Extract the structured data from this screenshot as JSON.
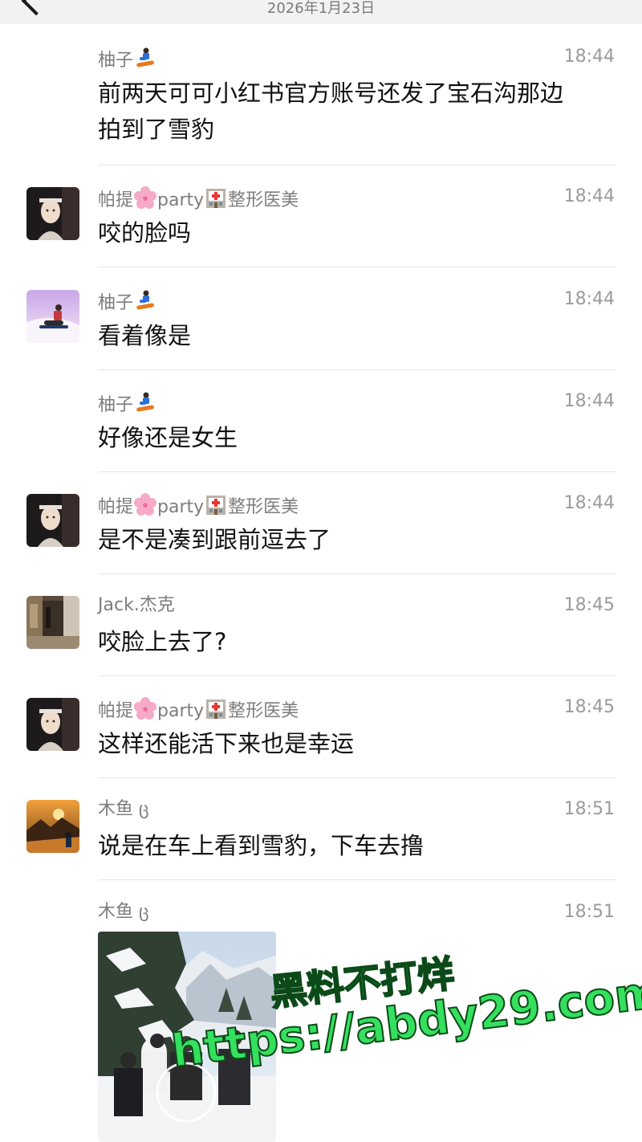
{
  "header": {
    "date": "2026年1月23日"
  },
  "messages": [
    {
      "sender": "柚子",
      "sender_emoji": "snowboarder-emoji",
      "time": "18:44",
      "text": "前两天可可小红书官方账号还发了宝石沟那边\n拍到了雪豹",
      "avatar": "none"
    },
    {
      "sender": "帕提",
      "sender_suffix_1": "party",
      "sender_suffix_2": "整形医美",
      "time": "18:44",
      "text": "咬的脸吗",
      "avatar": "woman-portrait"
    },
    {
      "sender": "柚子",
      "sender_emoji": "snowboarder-emoji",
      "time": "18:44",
      "text": "看着像是",
      "avatar": "snowboarder-photo"
    },
    {
      "sender": "柚子",
      "sender_emoji": "snowboarder-emoji",
      "time": "18:44",
      "text": "好像还是女生",
      "avatar": "none"
    },
    {
      "sender": "帕提",
      "sender_suffix_1": "party",
      "sender_suffix_2": "整形医美",
      "time": "18:44",
      "text": "是不是凑到跟前逗去了",
      "avatar": "woman-portrait"
    },
    {
      "sender": "Jack.杰克",
      "time": "18:45",
      "text": "咬脸上去了?",
      "avatar": "hallway-photo"
    },
    {
      "sender": "帕提",
      "sender_suffix_1": "party",
      "sender_suffix_2": "整形医美",
      "time": "18:45",
      "text": "这样还能活下来也是幸运",
      "avatar": "woman-portrait"
    },
    {
      "sender": "木鱼",
      "sender_suffix_1": "ც",
      "time": "18:51",
      "text": "说是在车上看到雪豹，下车去撸",
      "avatar": "mountain-sunset-photo"
    },
    {
      "sender": "木鱼",
      "sender_suffix_1": "ც",
      "time": "18:51",
      "text": "",
      "avatar": "none",
      "attachment": "video-thumbnail"
    }
  ],
  "watermark": {
    "line1": "黑料不打烊",
    "line2": "https://abdy29.com",
    "color": "#34e05e"
  },
  "colors": {
    "sender": "#7d7d7d",
    "time": "#9b9b9b",
    "text": "#111111",
    "divider": "#e6e6e6"
  }
}
